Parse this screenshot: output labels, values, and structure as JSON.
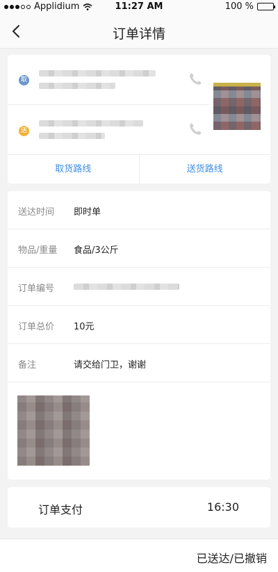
{
  "status_bar": {
    "carrier": "Applidium",
    "time": "11:27 AM",
    "battery": "100 %"
  },
  "nav": {
    "title": "订单详情",
    "back_icon": "chevron-left-icon"
  },
  "route": {
    "pickup_badge": "取",
    "delivery_badge": "送",
    "pickup_route_label": "取货路线",
    "delivery_route_label": "送货路线",
    "badge_colors": {
      "pickup": "#6b98c9",
      "delivery": "#f1b13a"
    },
    "link_color": "#3e8ee3"
  },
  "details": {
    "rows": [
      {
        "label": "送达时间",
        "value": "即时单"
      },
      {
        "label": "物品/重量",
        "value": "食品/3公斤"
      },
      {
        "label": "订单编号",
        "value": ""
      },
      {
        "label": "订单总价",
        "value": "10元"
      },
      {
        "label": "备注",
        "value": "请交给门卫，谢谢"
      }
    ]
  },
  "payment": {
    "label": "订单支付",
    "time": "16:30"
  },
  "footer": {
    "status_text": "已送达/已撤销"
  }
}
